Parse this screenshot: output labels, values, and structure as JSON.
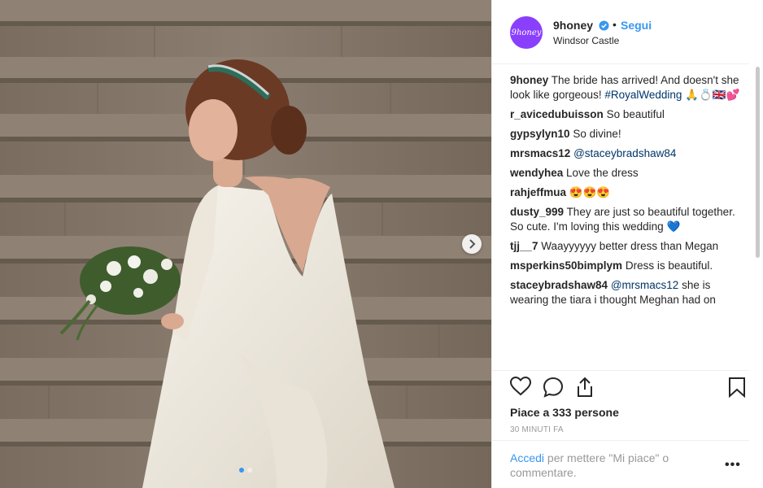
{
  "post": {
    "username": "9honey",
    "avatar_text": "9honey",
    "follow_label": "Segui",
    "separator": "•",
    "location": "Windsor Castle"
  },
  "comments": [
    {
      "user": "9honey",
      "text": "The bride has arrived! And doesn't she look like gorgeous!",
      "tag": "#RoyalWedding",
      "emoji": "🙏💍🇬🇧💕"
    },
    {
      "user": "r_avicedubuisson",
      "text": "So beautiful"
    },
    {
      "user": "gypsylyn10",
      "text": "So divine!"
    },
    {
      "user": "mrsmacs12",
      "text": "",
      "tag": "@staceybradshaw84"
    },
    {
      "user": "wendyhea",
      "text": "Love the dress"
    },
    {
      "user": "rahjeffmua",
      "text": "",
      "emoji": "😍😍😍"
    },
    {
      "user": "dusty_999",
      "text": "They are just so beautiful together. So cute. I'm loving this wedding",
      "emoji": "💙"
    },
    {
      "user": "tjj__7",
      "text": "Waayyyyyy better dress than Megan"
    },
    {
      "user": "msperkins50bimplym",
      "text": "Dress is beautiful."
    },
    {
      "user": "staceybradshaw84",
      "text": "she is wearing the tiara i thought Meghan had on",
      "tag_before": "@mrsmacs12"
    }
  ],
  "likes_text": "Piace a 333 persone",
  "time_text": "30 MINUTI FA",
  "login": {
    "link": "Accedi",
    "rest": "per mettere \"Mi piace\" o commentare."
  },
  "more_label": "•••",
  "colors": {
    "accent": "#3897f0",
    "avatar": "#8a3ffc",
    "text": "#262626",
    "muted": "#999999"
  },
  "icons": [
    "heart-icon",
    "comment-icon",
    "share-icon",
    "bookmark-icon",
    "verified-icon",
    "chevron-right-icon"
  ]
}
